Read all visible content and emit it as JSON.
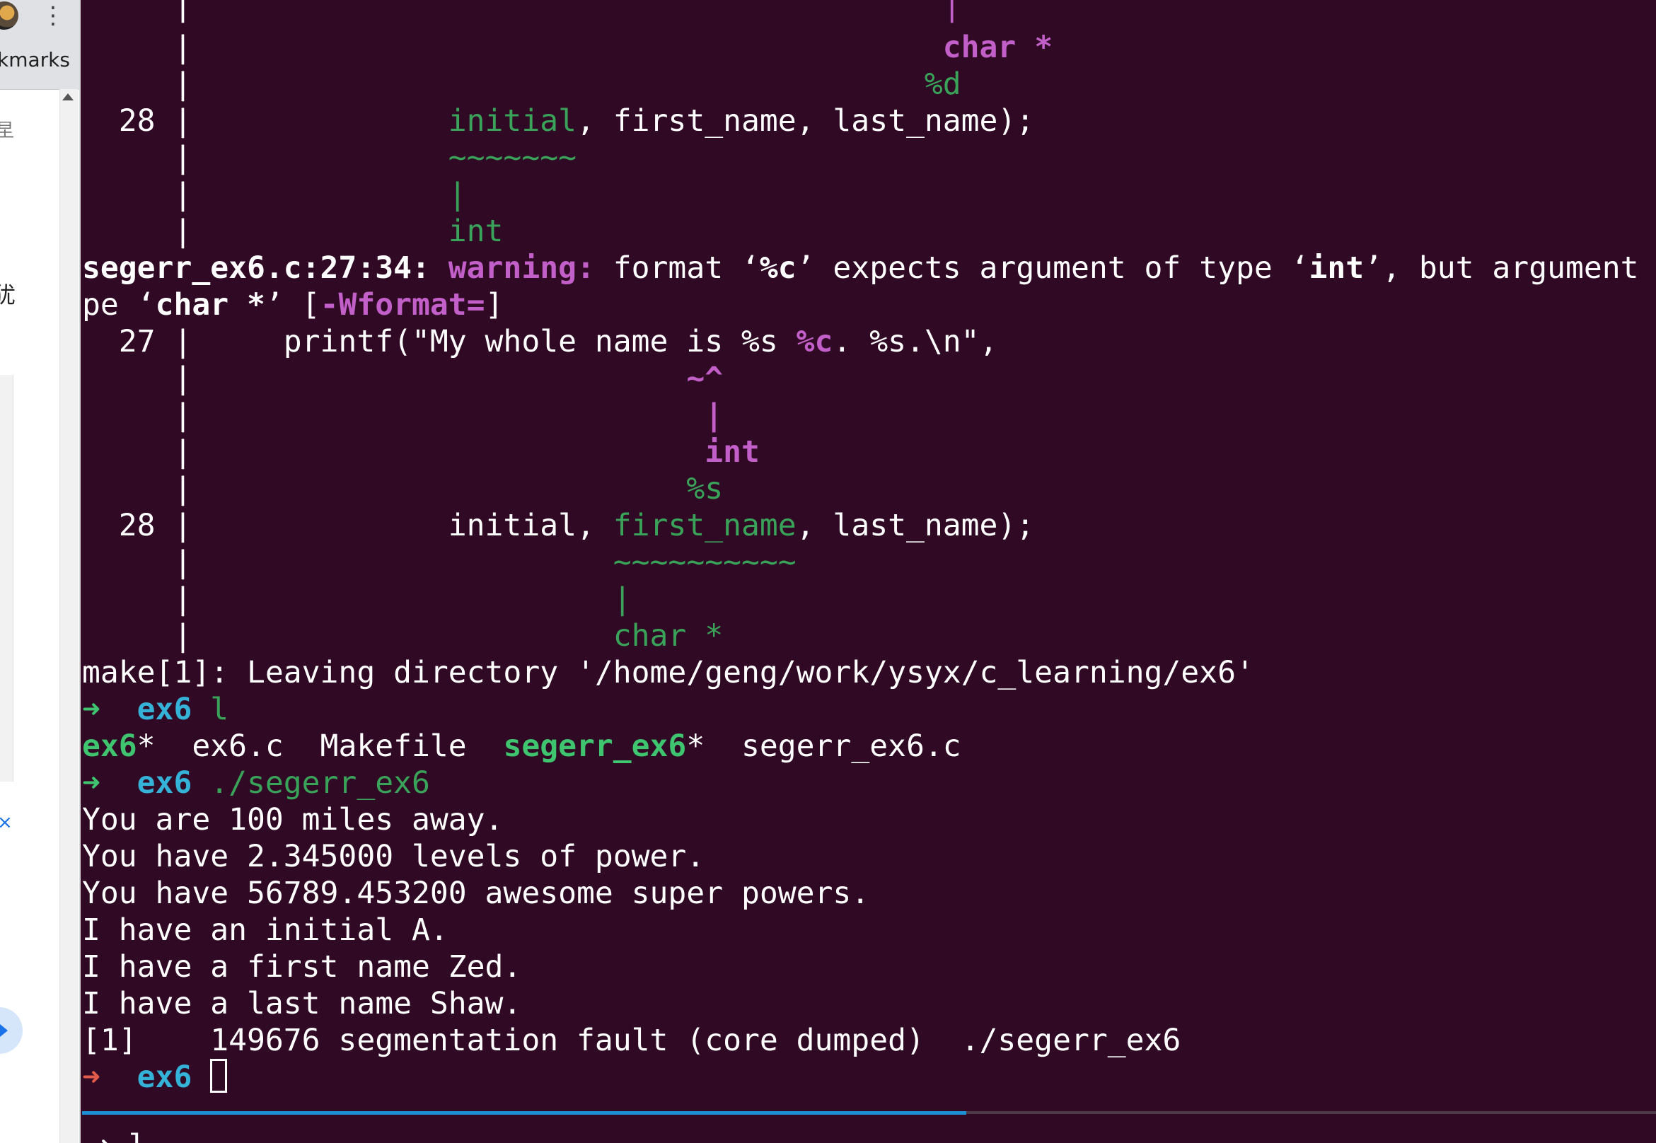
{
  "browser": {
    "menu_icon": "⋮",
    "bookmarks_label": "kmarks",
    "glyph_1": "圼",
    "glyph_2": "犹",
    "close_glyph": "×"
  },
  "terminal": {
    "lines": {
      "l00_pad": "                                        ",
      "l00": "|",
      "l01_pad": "                                        ",
      "l01": "char *",
      "l02_pad": "                                       ",
      "l02": "%d",
      "l03_num": "  28 | ",
      "l03_pad": "             ",
      "l03_a": "initial",
      "l03_b": ", first_name, last_name);",
      "l04_gutter": "     | ",
      "l04_pad": "             ",
      "l04": "~~~~~~~",
      "l05_gutter": "     | ",
      "l05_pad": "             ",
      "l05": "|",
      "l06_gutter": "     | ",
      "l06_pad": "             ",
      "l06": "int",
      "l07_file": "segerr_ex6.c:27:34: ",
      "l07_warn": "warning: ",
      "l07_t1": "format ‘",
      "l07_f1": "%c",
      "l07_t2": "’ expects argument of type ‘",
      "l07_f2": "int",
      "l07_t3": "’, but argument",
      "l08_t1": "pe ‘",
      "l08_f1": "char *",
      "l08_t2": "’ [",
      "l08_flag": "-Wformat=",
      "l08_t3": "]",
      "l09_num": "  27 | ",
      "l09_a": "    printf(\"My whole name is %s ",
      "l09_b": "%c",
      "l09_c": ". %s.\\n\",",
      "l10_gutter": "     | ",
      "l10_pad": "                          ",
      "l10": "~^",
      "l11_gutter": "     | ",
      "l11_pad": "                           ",
      "l11": "|",
      "l12_gutter": "     | ",
      "l12_pad": "                           ",
      "l12": "int",
      "l13_gutter": "     | ",
      "l13_pad": "                          ",
      "l13": "%s",
      "l14_num": "  28 | ",
      "l14_a": "             initial, ",
      "l14_b": "first_name",
      "l14_c": ", last_name);",
      "l15_gutter": "     | ",
      "l15_pad": "                      ",
      "l15": "~~~~~~~~~~",
      "l16_gutter": "     | ",
      "l16_pad": "                      ",
      "l16": "|",
      "l17_gutter": "     | ",
      "l17_pad": "                      ",
      "l17": "char *",
      "l18": "make[1]: Leaving directory '/home/geng/work/ysyx/c_learning/ex6'",
      "l19_arrow": "➜  ",
      "l19_dir": "ex6",
      "l19_cmd": " l",
      "l20_a": "ex6",
      "l20_b": "*  ex6.c  Makefile  ",
      "l20_c": "segerr_ex6",
      "l20_d": "*  segerr_ex6.c",
      "l21_arrow": "➜  ",
      "l21_dir": "ex6",
      "l21_cmd": " ./segerr_ex6",
      "l22": "You are 100 miles away.",
      "l23": "You have 2.345000 levels of power.",
      "l24": "You have 56789.453200 awesome super powers.",
      "l25": "I have an initial A.",
      "l26": "I have a first name Zed.",
      "l27": "I have a last name Shaw.",
      "l28": "[1]    149676 segmentation fault (core dumped)  ./segerr_ex6",
      "l29_arrow": "➜  ",
      "l29_dir": "ex6",
      "l29_sp": " ",
      "bottom": "➜ l"
    },
    "colors": {
      "background": "#300a24",
      "magenta": "#c25fc9",
      "green": "#3aa35a",
      "prompt_dir": "#35b2d8",
      "prompt_arrow_error": "#e35b4a",
      "divider_accent": "#1e90d6"
    }
  }
}
